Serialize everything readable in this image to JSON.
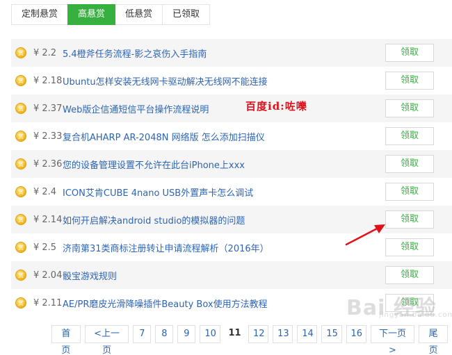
{
  "tabs": [
    {
      "label": "定制悬赏",
      "active": false
    },
    {
      "label": "高悬赏",
      "active": true
    },
    {
      "label": "低悬赏",
      "active": false
    },
    {
      "label": "已领取",
      "active": false
    }
  ],
  "tasks": [
    {
      "reward": "¥ 2.2",
      "title": "5.4橙斧任务流程-影之哀伤入手指南",
      "action": "领取"
    },
    {
      "reward": "¥ 2.18",
      "title": "Ubuntu怎样安装无线网卡驱动解决无线网不能连接",
      "action": "领取"
    },
    {
      "reward": "¥ 2.37",
      "title": "Web版企信通短信平台操作流程说明",
      "action": "领取"
    },
    {
      "reward": "¥ 2.33",
      "title": "复合机AHARP AR-2048N 网络版 怎么添加扫描仪",
      "action": "领取"
    },
    {
      "reward": "¥ 2.36",
      "title": "您的设备管理设置不允许在此台iPhone上xxx",
      "action": "领取"
    },
    {
      "reward": "¥ 2.4",
      "title": "ICON艾肯CUBE 4nano USB外置声卡怎么调试",
      "action": "领取"
    },
    {
      "reward": "¥ 2.14",
      "title": "如何开启解决android studio的模拟器的问题",
      "action": "领取"
    },
    {
      "reward": "¥ 2.5",
      "title": "济南第31类商标注册转让申请流程解析（2016年）",
      "action": "领取"
    },
    {
      "reward": "¥ 2.04",
      "title": "骰宝游戏规则",
      "action": "领取"
    },
    {
      "reward": "¥ 2.11",
      "title": "AE/PR磨皮光滑降噪插件Beauty Box使用方法教程",
      "action": "领取"
    }
  ],
  "annotation": {
    "text": "百度id:咗嚛",
    "color": "#e0101a"
  },
  "pagination": {
    "first": "首页",
    "prev": "<上一页",
    "pages": [
      "7",
      "8",
      "9",
      "10",
      "11",
      "12",
      "13",
      "14",
      "15",
      "16"
    ],
    "current": "11",
    "next": "下一页>",
    "last": "尾页"
  },
  "watermark": {
    "brand": "Bai 经验",
    "sub": "jingyan.baidu.com"
  },
  "colors": {
    "accent": "#38b03f",
    "link": "#2d64b3",
    "arrow": "#e0101a"
  }
}
